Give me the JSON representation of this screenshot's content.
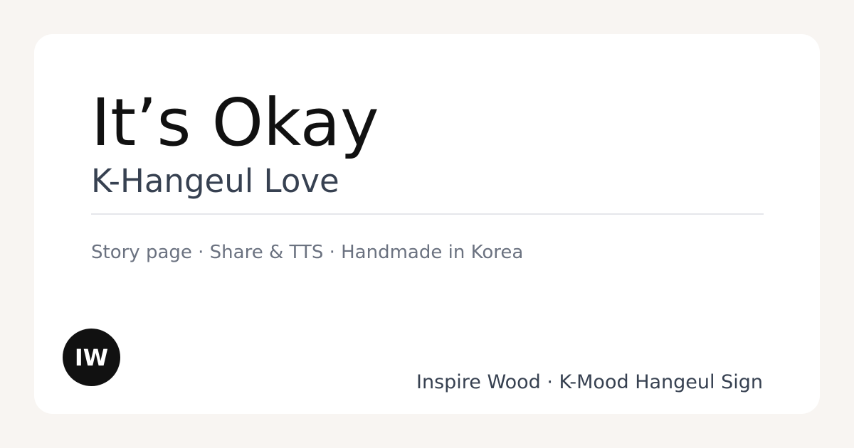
{
  "card": {
    "title": "It’s Okay",
    "subtitle": "K-Hangeul Love",
    "tagline": "Story page · Share & TTS · Handmade in Korea",
    "logo_text": "IW",
    "footer": "Inspire Wood · K-Mood Hangeul Sign"
  },
  "colors": {
    "background": "#f8f5f2",
    "card": "#ffffff",
    "logo": "#111111"
  }
}
